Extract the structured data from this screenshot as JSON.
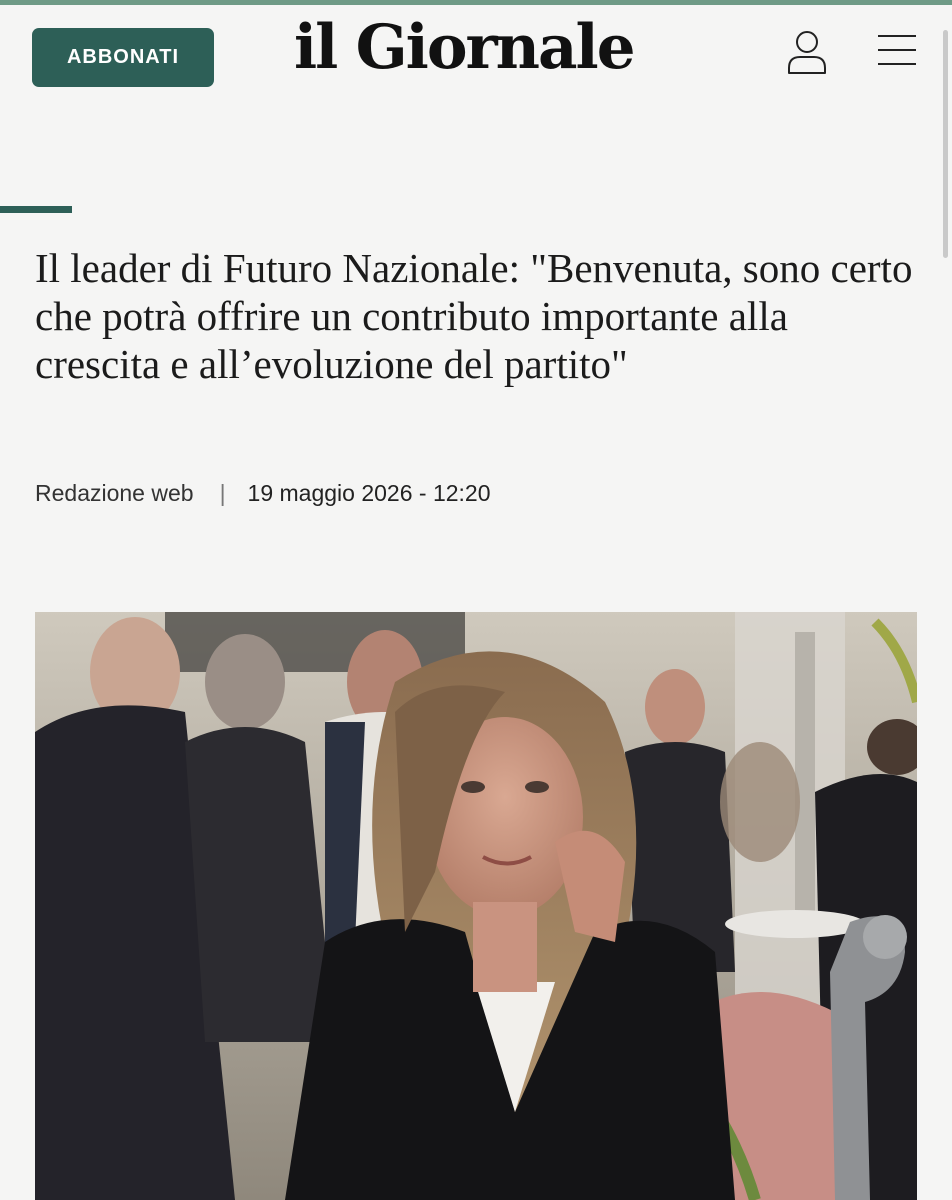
{
  "header": {
    "subscribe_label": "ABBONATI",
    "logo": "il Giornale",
    "user_icon": "user-icon",
    "menu_icon": "hamburger-menu-icon"
  },
  "article": {
    "headline": "Il leader di Futuro Nazionale: \"Benvenuta, sono certo che potrà offrire un contributo importante alla crescita e all’evoluzione del partito\"",
    "author": "Redazione web",
    "separator": "|",
    "date": "19 maggio 2026 - 12:20"
  },
  "colors": {
    "brand": "#2d5f57",
    "top_strip": "#6f9a86",
    "background": "#f5f5f4"
  }
}
